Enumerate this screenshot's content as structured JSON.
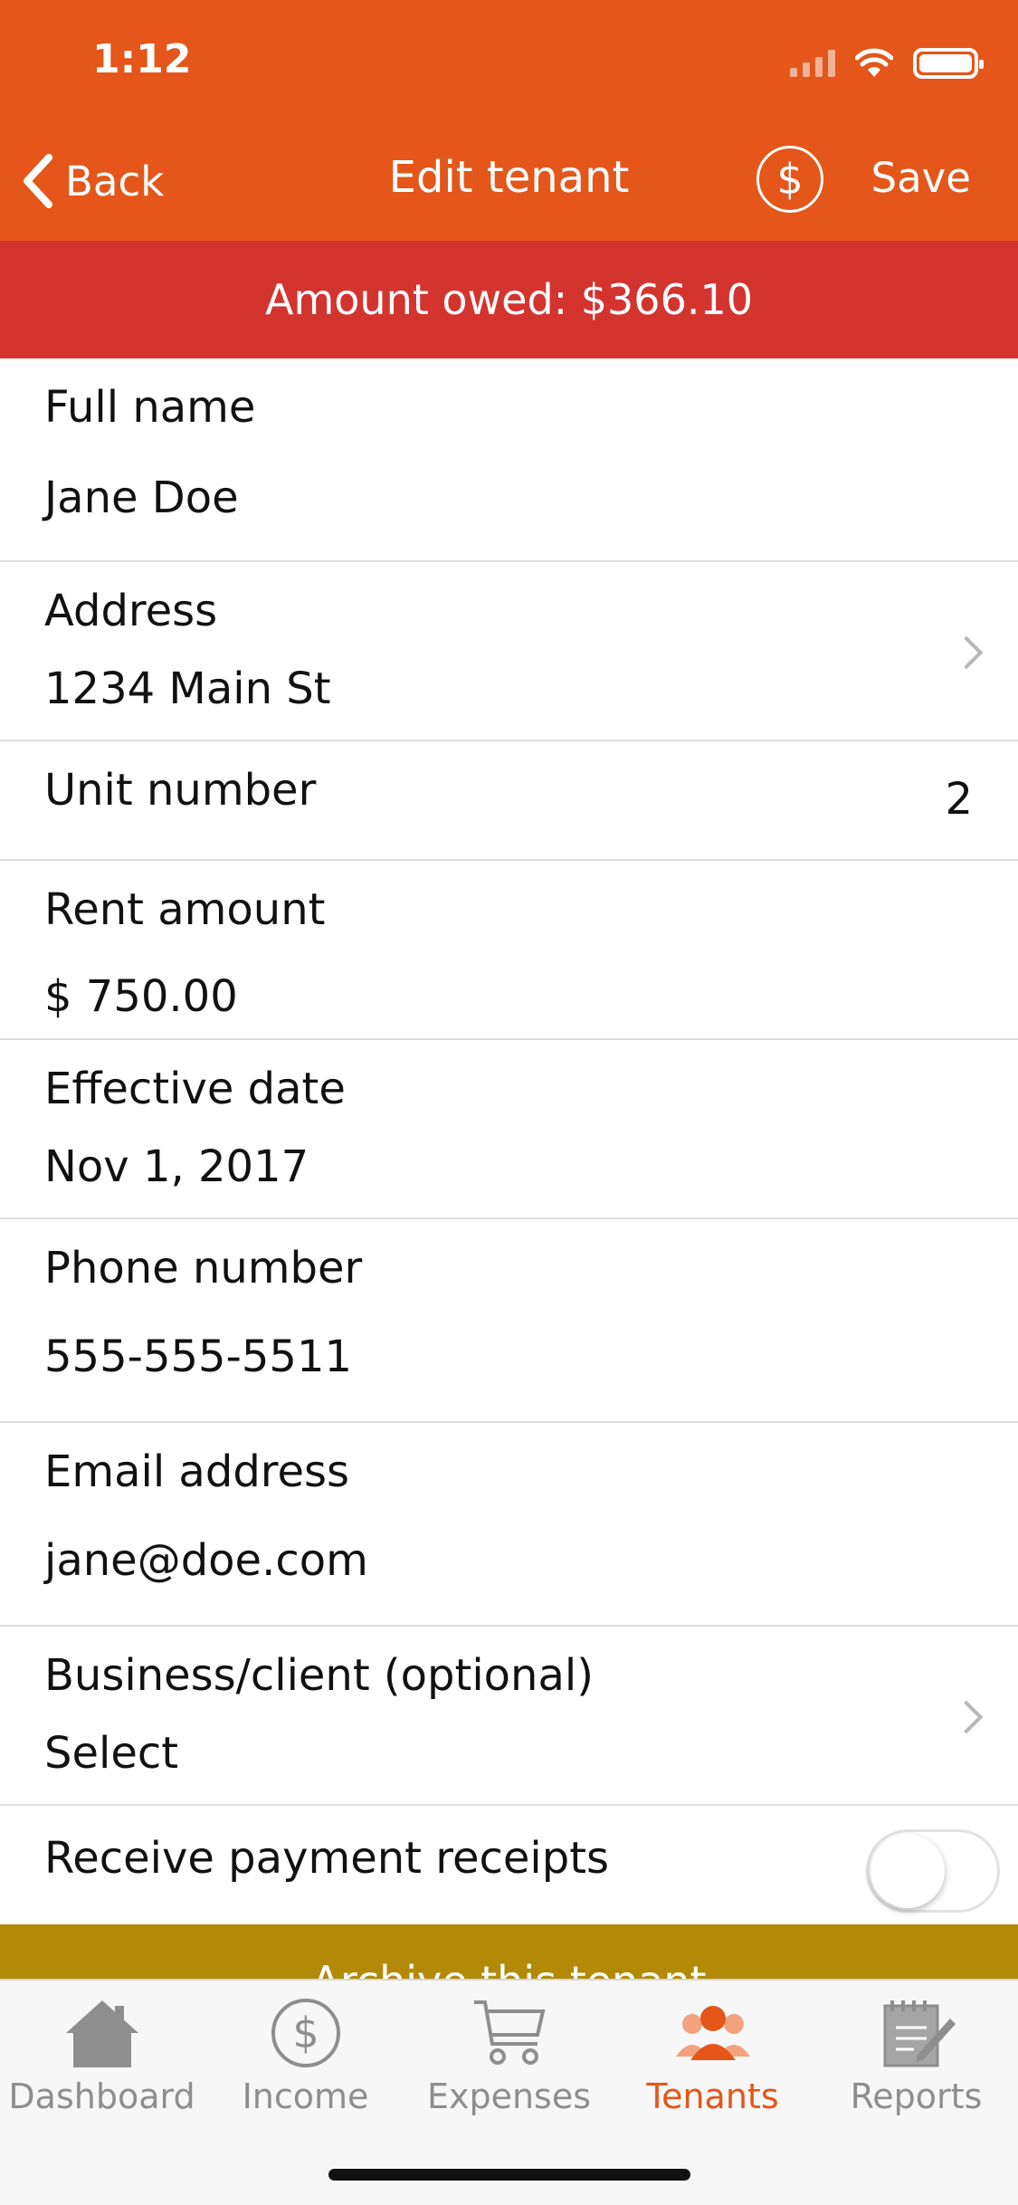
{
  "status_bar": {
    "time": "1:12"
  },
  "nav": {
    "back_label": "Back",
    "title": "Edit tenant",
    "dollar_symbol": "$",
    "save_label": "Save"
  },
  "banner": {
    "amount_owed": "Amount owed: $366.10"
  },
  "form": {
    "full_name": {
      "label": "Full name",
      "value": "Jane Doe"
    },
    "address": {
      "label": "Address",
      "value": "1234 Main St"
    },
    "unit_number": {
      "label": "Unit number",
      "value": "2"
    },
    "rent_amount": {
      "label": "Rent amount",
      "value": "$ 750.00"
    },
    "effective_date": {
      "label": "Effective date",
      "value": "Nov 1, 2017"
    },
    "phone_number": {
      "label": "Phone number",
      "value": "555-555-5511"
    },
    "email_address": {
      "label": "Email address",
      "value": "jane@doe.com"
    },
    "business_client": {
      "label": "Business/client (optional)",
      "value": "Select"
    },
    "receive_receipts": {
      "label": "Receive payment receipts",
      "enabled": false
    }
  },
  "archive": {
    "label": "Archive this tenant"
  },
  "tabs": [
    {
      "label": "Dashboard",
      "icon": "house-icon",
      "active": false
    },
    {
      "label": "Income",
      "icon": "dollar-circle-icon",
      "active": false
    },
    {
      "label": "Expenses",
      "icon": "shopping-cart-icon",
      "active": false
    },
    {
      "label": "Tenants",
      "icon": "people-icon",
      "active": true
    },
    {
      "label": "Reports",
      "icon": "notepad-pencil-icon",
      "active": false
    }
  ],
  "colors": {
    "nav_orange": "#E4561A",
    "owed_red": "#D3342E",
    "archive_gold": "#B38A08",
    "tab_active": "#E4561A",
    "tab_inactive": "#8E8E8E"
  }
}
